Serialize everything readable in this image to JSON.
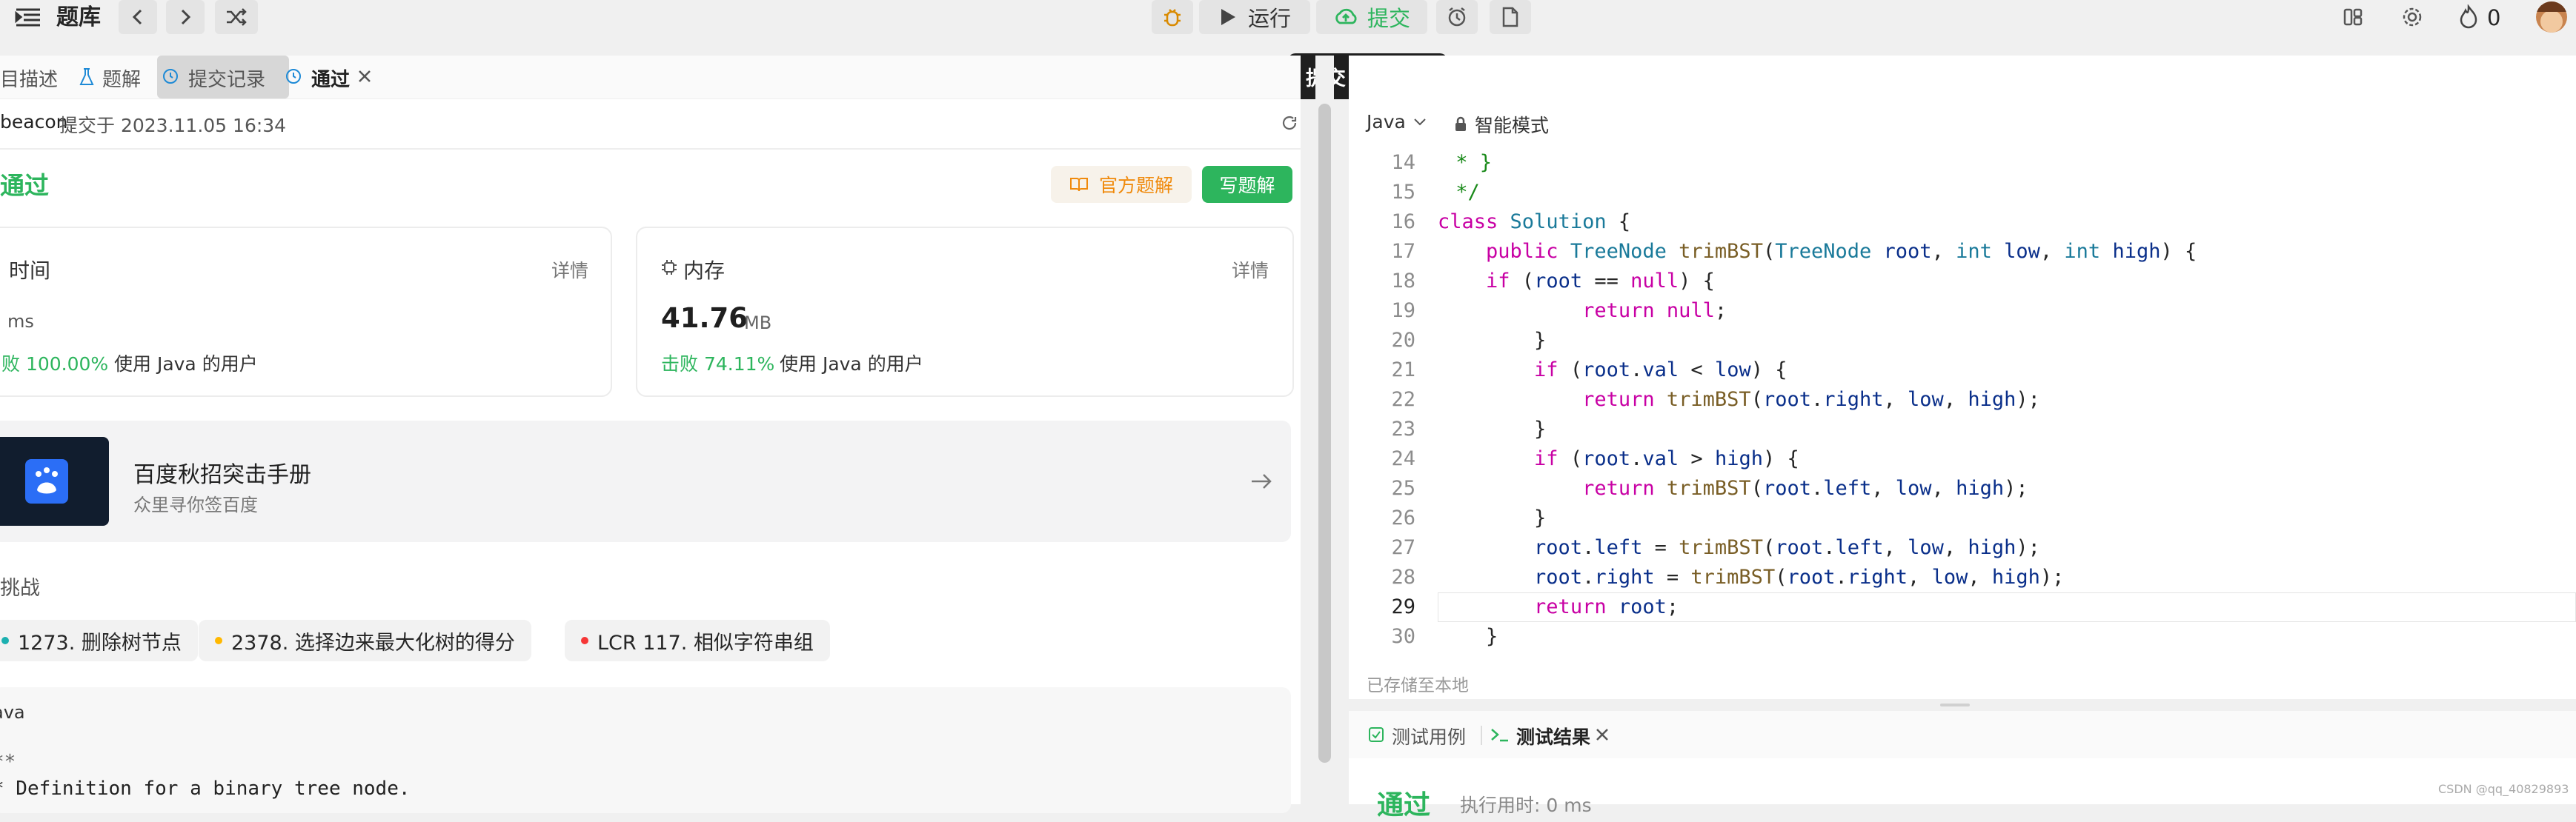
{
  "topbar": {
    "title": "题库",
    "run_label": "运行",
    "submit_label": "提交",
    "streak_count": "0"
  },
  "tooltip": {
    "label": "提交",
    "shortcut": "⌘",
    "enter": "↩"
  },
  "tabs": [
    {
      "label": "目描述"
    },
    {
      "label": "题解"
    },
    {
      "label": "提交记录"
    },
    {
      "label": "通过"
    }
  ],
  "submission": {
    "user": "beacon",
    "submitted_at": "提交于 2023.11.05 16:34",
    "status": "通过",
    "official_solution": "官方题解",
    "write_solution": "写题解"
  },
  "time_card": {
    "title": "时间",
    "detail": "详情",
    "unit": "ms",
    "beat_prefix": "败 100.00%",
    "beat_suffix": "使用 Java 的用户"
  },
  "memory_card": {
    "title": "内存",
    "detail": "详情",
    "value": "41.76",
    "unit": "MB",
    "beat_prefix": "击败 74.11%",
    "beat_suffix": "使用 Java 的用户"
  },
  "promo": {
    "title": "百度秋招突击手册",
    "subtitle": "众里寻你签百度"
  },
  "challenge": {
    "heading": "挑战",
    "items": [
      {
        "label": "1273. 删除树节点",
        "color": "#1cb0b0"
      },
      {
        "label": "2378. 选择边来最大化树的得分",
        "color": "#ffb800"
      },
      {
        "label": "LCR 117. 相似字符串组",
        "color": "#f63636"
      }
    ]
  },
  "code_preview": {
    "lang": "ava",
    "lines": [
      "**",
      "* Definition for a binary tree node."
    ]
  },
  "editor": {
    "lang": "Java",
    "mode": "智能模式",
    "saved": "已存储至本地",
    "lines": [
      {
        "n": "14",
        "text": " * }"
      },
      {
        "n": "15",
        "text": " */"
      },
      {
        "n": "16",
        "text": "class Solution {"
      },
      {
        "n": "17",
        "text": "    public TreeNode trimBST(TreeNode root, int low, int high) {"
      },
      {
        "n": "18",
        "text": "    if (root == null) {"
      },
      {
        "n": "19",
        "text": "            return null;"
      },
      {
        "n": "20",
        "text": "        }"
      },
      {
        "n": "21",
        "text": "        if (root.val < low) {"
      },
      {
        "n": "22",
        "text": "            return trimBST(root.right, low, high);"
      },
      {
        "n": "23",
        "text": "        }"
      },
      {
        "n": "24",
        "text": "        if (root.val > high) {"
      },
      {
        "n": "25",
        "text": "            return trimBST(root.left, low, high);"
      },
      {
        "n": "26",
        "text": "        }"
      },
      {
        "n": "27",
        "text": "        root.left = trimBST(root.left, low, high);"
      },
      {
        "n": "28",
        "text": "        root.right = trimBST(root.right, low, high);"
      },
      {
        "n": "29",
        "text": "        return root;"
      },
      {
        "n": "30",
        "text": "    }"
      }
    ]
  },
  "bottom": {
    "tab_testcase": "测试用例",
    "tab_result": "测试结果",
    "result_status": "通过",
    "exec_time": "执行用时: 0 ms"
  },
  "watermark": "CSDN @qq_40829893"
}
